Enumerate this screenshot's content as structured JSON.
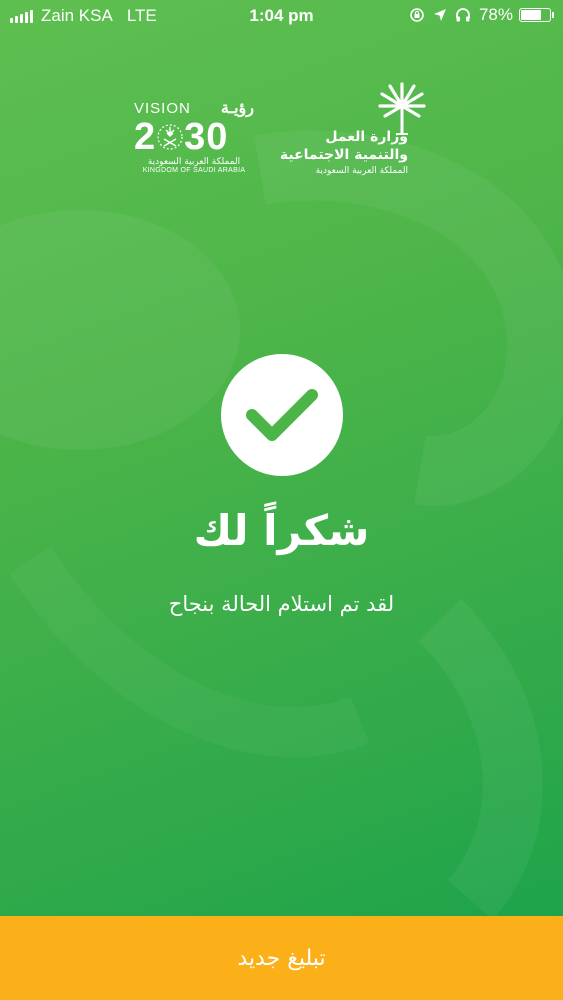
{
  "status_bar": {
    "carrier": "Zain KSA",
    "network": "LTE",
    "time": "1:04 pm",
    "battery_percent": "78%",
    "battery_level": 0.78,
    "icons": [
      "signal-icon",
      "orientation-lock-icon",
      "location-icon",
      "headphones-icon",
      "battery-icon"
    ]
  },
  "logos": {
    "vision": {
      "word": "VISION",
      "arabic": "رؤيـة",
      "year_left": "2",
      "year_right": "30",
      "arabic_sub": "المملكة العربية السعودية",
      "english_sub": "KINGDOM OF SAUDI ARABIA"
    },
    "ministry": {
      "line1": "وزارة العمل",
      "line2": "والتنمية الاجتماعية",
      "line3": "المملكة العربية السعودية"
    }
  },
  "confirmation": {
    "icon": "check-icon",
    "title": "شكراً لك",
    "message": "لقد تم استلام الحالة بنجاح"
  },
  "actions": {
    "new_report_label": "تبليغ جديد"
  },
  "colors": {
    "background_green": "#4db549",
    "button_orange": "#fbb01a",
    "check_green": "#4cb548"
  }
}
